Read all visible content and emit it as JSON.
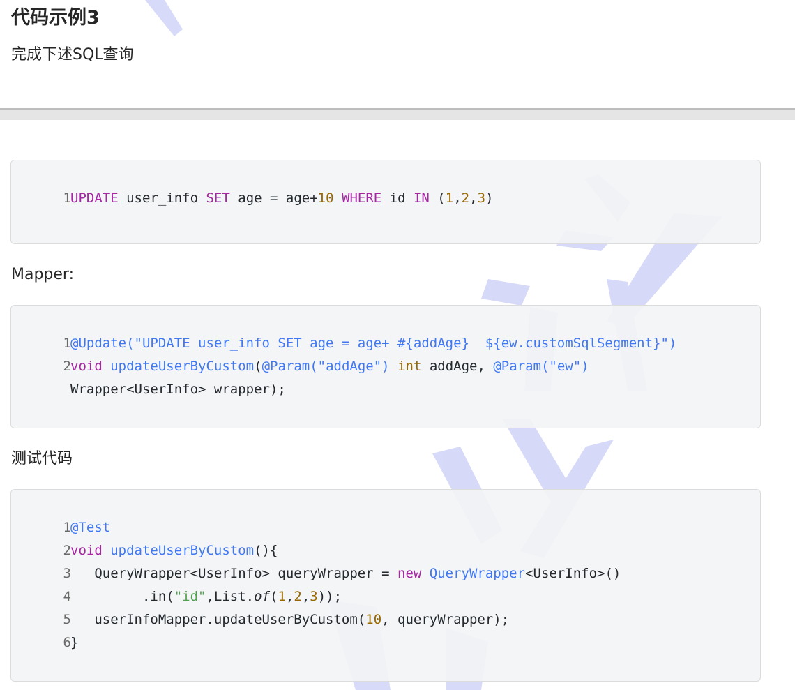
{
  "title": "代码示例3",
  "subtitle": "完成下述SQL查询",
  "mapper_label": "Mapper:",
  "test_label": "测试代码",
  "sql_block": {
    "lines": [
      {
        "n": "1",
        "tokens": [
          {
            "t": "UPDATE",
            "c": "kw"
          },
          {
            "t": " user_info ",
            "c": "plain"
          },
          {
            "t": "SET",
            "c": "kw"
          },
          {
            "t": " age = age+",
            "c": "plain"
          },
          {
            "t": "10",
            "c": "num"
          },
          {
            "t": " ",
            "c": "plain"
          },
          {
            "t": "WHERE",
            "c": "kw"
          },
          {
            "t": " id ",
            "c": "plain"
          },
          {
            "t": "IN",
            "c": "kw"
          },
          {
            "t": " (",
            "c": "plain"
          },
          {
            "t": "1",
            "c": "num"
          },
          {
            "t": ",",
            "c": "plain"
          },
          {
            "t": "2",
            "c": "num"
          },
          {
            "t": ",",
            "c": "plain"
          },
          {
            "t": "3",
            "c": "num"
          },
          {
            "t": ")",
            "c": "plain"
          }
        ]
      }
    ]
  },
  "mapper_block": {
    "lines": [
      {
        "n": "1",
        "tokens": [
          {
            "t": "@Update(\"UPDATE user_info SET age = age+ #{addAge}  ${ew.customSqlSegment}\")",
            "c": "fn"
          }
        ]
      },
      {
        "n": "2",
        "tokens": [
          {
            "t": "void",
            "c": "kw"
          },
          {
            "t": " ",
            "c": "plain"
          },
          {
            "t": "updateUserByCustom",
            "c": "fn"
          },
          {
            "t": "(",
            "c": "plain"
          },
          {
            "t": "@Param(\"addAge\")",
            "c": "fn"
          },
          {
            "t": " ",
            "c": "plain"
          },
          {
            "t": "int",
            "c": "num"
          },
          {
            "t": " addAge, ",
            "c": "plain"
          },
          {
            "t": "@Param(\"ew\")",
            "c": "fn"
          }
        ]
      },
      {
        "n": "",
        "tokens": [
          {
            "t": "Wrapper<UserInfo> wrapper);",
            "c": "plain"
          }
        ]
      }
    ]
  },
  "test_block": {
    "lines": [
      {
        "n": "1",
        "tokens": [
          {
            "t": "@Test",
            "c": "fn"
          }
        ]
      },
      {
        "n": "2",
        "tokens": [
          {
            "t": "void",
            "c": "kw"
          },
          {
            "t": " ",
            "c": "plain"
          },
          {
            "t": "updateUserByCustom",
            "c": "fn"
          },
          {
            "t": "(){",
            "c": "plain"
          }
        ]
      },
      {
        "n": "3",
        "tokens": [
          {
            "t": "   QueryWrapper<UserInfo> queryWrapper = ",
            "c": "plain"
          },
          {
            "t": "new",
            "c": "kw"
          },
          {
            "t": " ",
            "c": "plain"
          },
          {
            "t": "QueryWrapper",
            "c": "fn"
          },
          {
            "t": "<UserInfo>()",
            "c": "plain"
          }
        ]
      },
      {
        "n": "4",
        "tokens": [
          {
            "t": "         .in(",
            "c": "plain"
          },
          {
            "t": "\"id\"",
            "c": "str"
          },
          {
            "t": ",List.",
            "c": "plain"
          },
          {
            "t": "of",
            "c": "it"
          },
          {
            "t": "(",
            "c": "plain"
          },
          {
            "t": "1",
            "c": "num"
          },
          {
            "t": ",",
            "c": "plain"
          },
          {
            "t": "2",
            "c": "num"
          },
          {
            "t": ",",
            "c": "plain"
          },
          {
            "t": "3",
            "c": "num"
          },
          {
            "t": "));",
            "c": "plain"
          }
        ]
      },
      {
        "n": "5",
        "tokens": [
          {
            "t": "   userInfoMapper.updateUserByCustom(",
            "c": "plain"
          },
          {
            "t": "10",
            "c": "num"
          },
          {
            "t": ", queryWrapper);",
            "c": "plain"
          }
        ]
      },
      {
        "n": "6",
        "tokens": [
          {
            "t": "}",
            "c": "plain"
          }
        ]
      }
    ]
  },
  "colors": {
    "keyword": "#a626a4",
    "number": "#986801",
    "function": "#4078f2",
    "string": "#50a14f",
    "watermark": "#c9cdf6"
  }
}
